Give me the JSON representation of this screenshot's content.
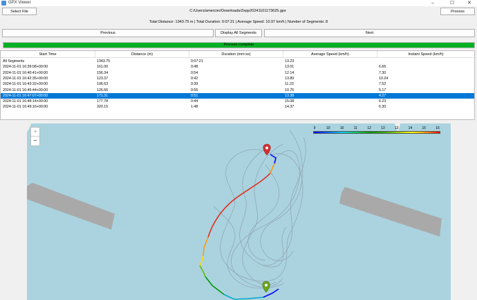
{
  "window": {
    "title": "GPX Viewer"
  },
  "toolbar": {
    "select_file_label": "Select File",
    "file_path": "C:/Users/amercier/Downloads/Zepp20241101173625.gpx",
    "process_label": "Process"
  },
  "summary": "Total Distance: 1343.75 m | Total Duration: 0:07:21 | Average Speed: 10.97 km/h | Number of Segments: 8",
  "nav": {
    "previous_label": "Previous",
    "display_all_label": "Display All Segments",
    "next_label": "Next"
  },
  "progress": {
    "text": "Process complete",
    "value": 1.0
  },
  "table": {
    "headers": [
      "Start Time",
      "Distance (m)",
      "Duration (mm:ss)",
      "Average Speed (km/h)",
      "Instant Speed (km/h)"
    ],
    "rows": [
      [
        "All Segments",
        "1343.75",
        "0:07:21",
        "13.23",
        ""
      ],
      [
        "2024-11-01 16:39:08+00:00",
        "161.00",
        "0:48",
        "13.01",
        "6.66"
      ],
      [
        "2024-11-01 16:40:41+00:00",
        "156.34",
        "0:54",
        "12.14",
        "7.30"
      ],
      [
        "2024-11-01 16:42:35+00:00",
        "123.37",
        "0:42",
        "13.89",
        "10.24"
      ],
      [
        "2024-11-01 16:43:32+00:00",
        "106.63",
        "0:39",
        "11.23",
        "7.52"
      ],
      [
        "2024-11-01 16:45:44+00:00",
        "126.66",
        "0:55",
        "10.75",
        "5.17"
      ],
      [
        "2024-11-01 16:47:07+00:00",
        "171.31",
        "0:51",
        "13.38",
        "4.27"
      ],
      [
        "2024-11-01 16:48:14+00:00",
        "177.78",
        "0:44",
        "15.08",
        "6.23"
      ],
      [
        "2024-11-01 16:49:16+00:00",
        "320.15",
        "1:48",
        "14.37",
        "6.30"
      ]
    ],
    "selected_index": 6
  },
  "map": {
    "zoom_in": "+",
    "zoom_out": "−",
    "legend_ticks": [
      "9",
      "10",
      "10",
      "11",
      "12",
      "13",
      "13",
      "14",
      "15",
      "16"
    ],
    "start_marker_color": "#6aa51f",
    "end_marker_color": "#d03030"
  },
  "colors": {
    "selection": "#0078d7",
    "progress": "#06b025",
    "water": "#aad3df"
  }
}
